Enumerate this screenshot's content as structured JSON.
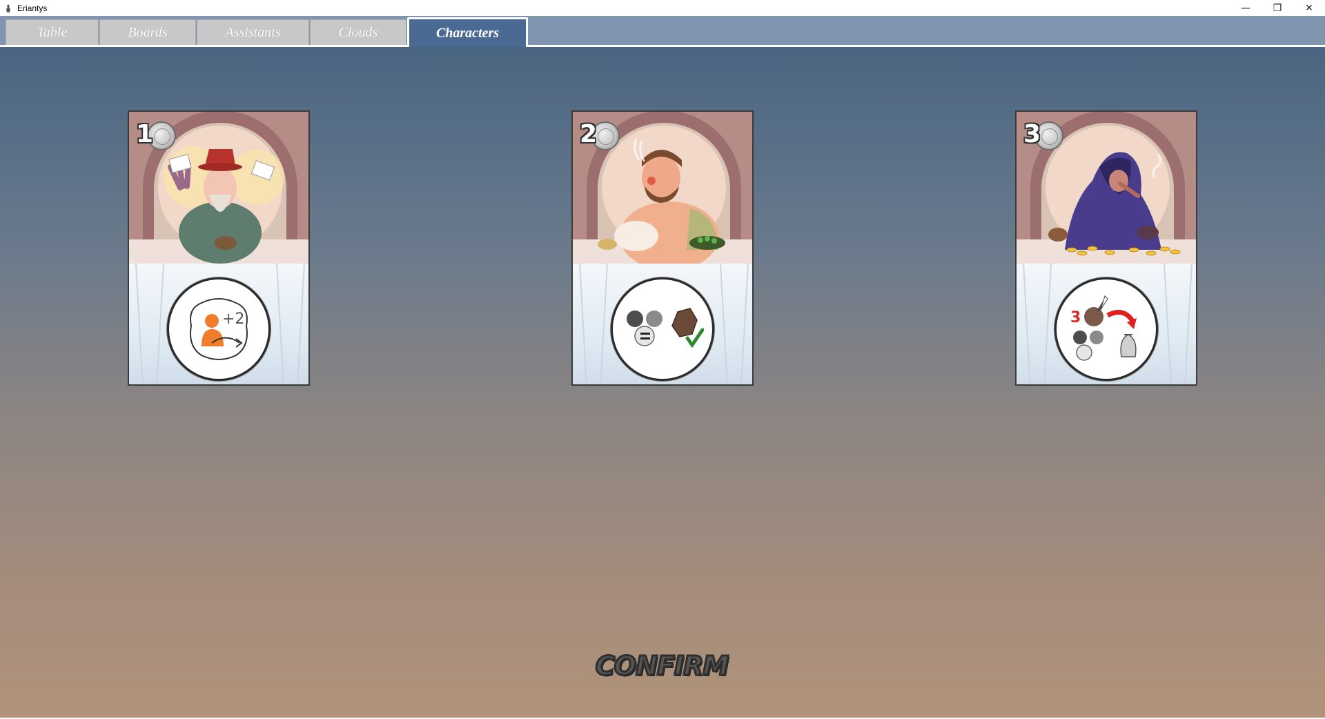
{
  "window": {
    "title": "Eriantys",
    "controls": {
      "minimize": "—",
      "restore": "❐",
      "close": "✕"
    }
  },
  "tabs": [
    {
      "label": "Table",
      "active": false
    },
    {
      "label": "Boards",
      "active": false
    },
    {
      "label": "Assistants",
      "active": false
    },
    {
      "label": "Clouds",
      "active": false
    },
    {
      "label": "Characters",
      "active": true
    }
  ],
  "cards": [
    {
      "cost": "1",
      "effect_badge": "+2",
      "icon": "influence-plus-two-icon"
    },
    {
      "cost": "2",
      "icon": "students-equal-tower-check-icon"
    },
    {
      "cost": "3",
      "effect_badge": "3",
      "icon": "students-to-bag-icon"
    }
  ],
  "confirm": {
    "label": "CONFIRM"
  },
  "colors": {
    "tab_active": "#4a6a94",
    "tab_inactive": "#c8c8c8",
    "tabstrip": "#7f95b0",
    "bg_top": "#4a6582",
    "bg_bottom": "#b0937a"
  }
}
